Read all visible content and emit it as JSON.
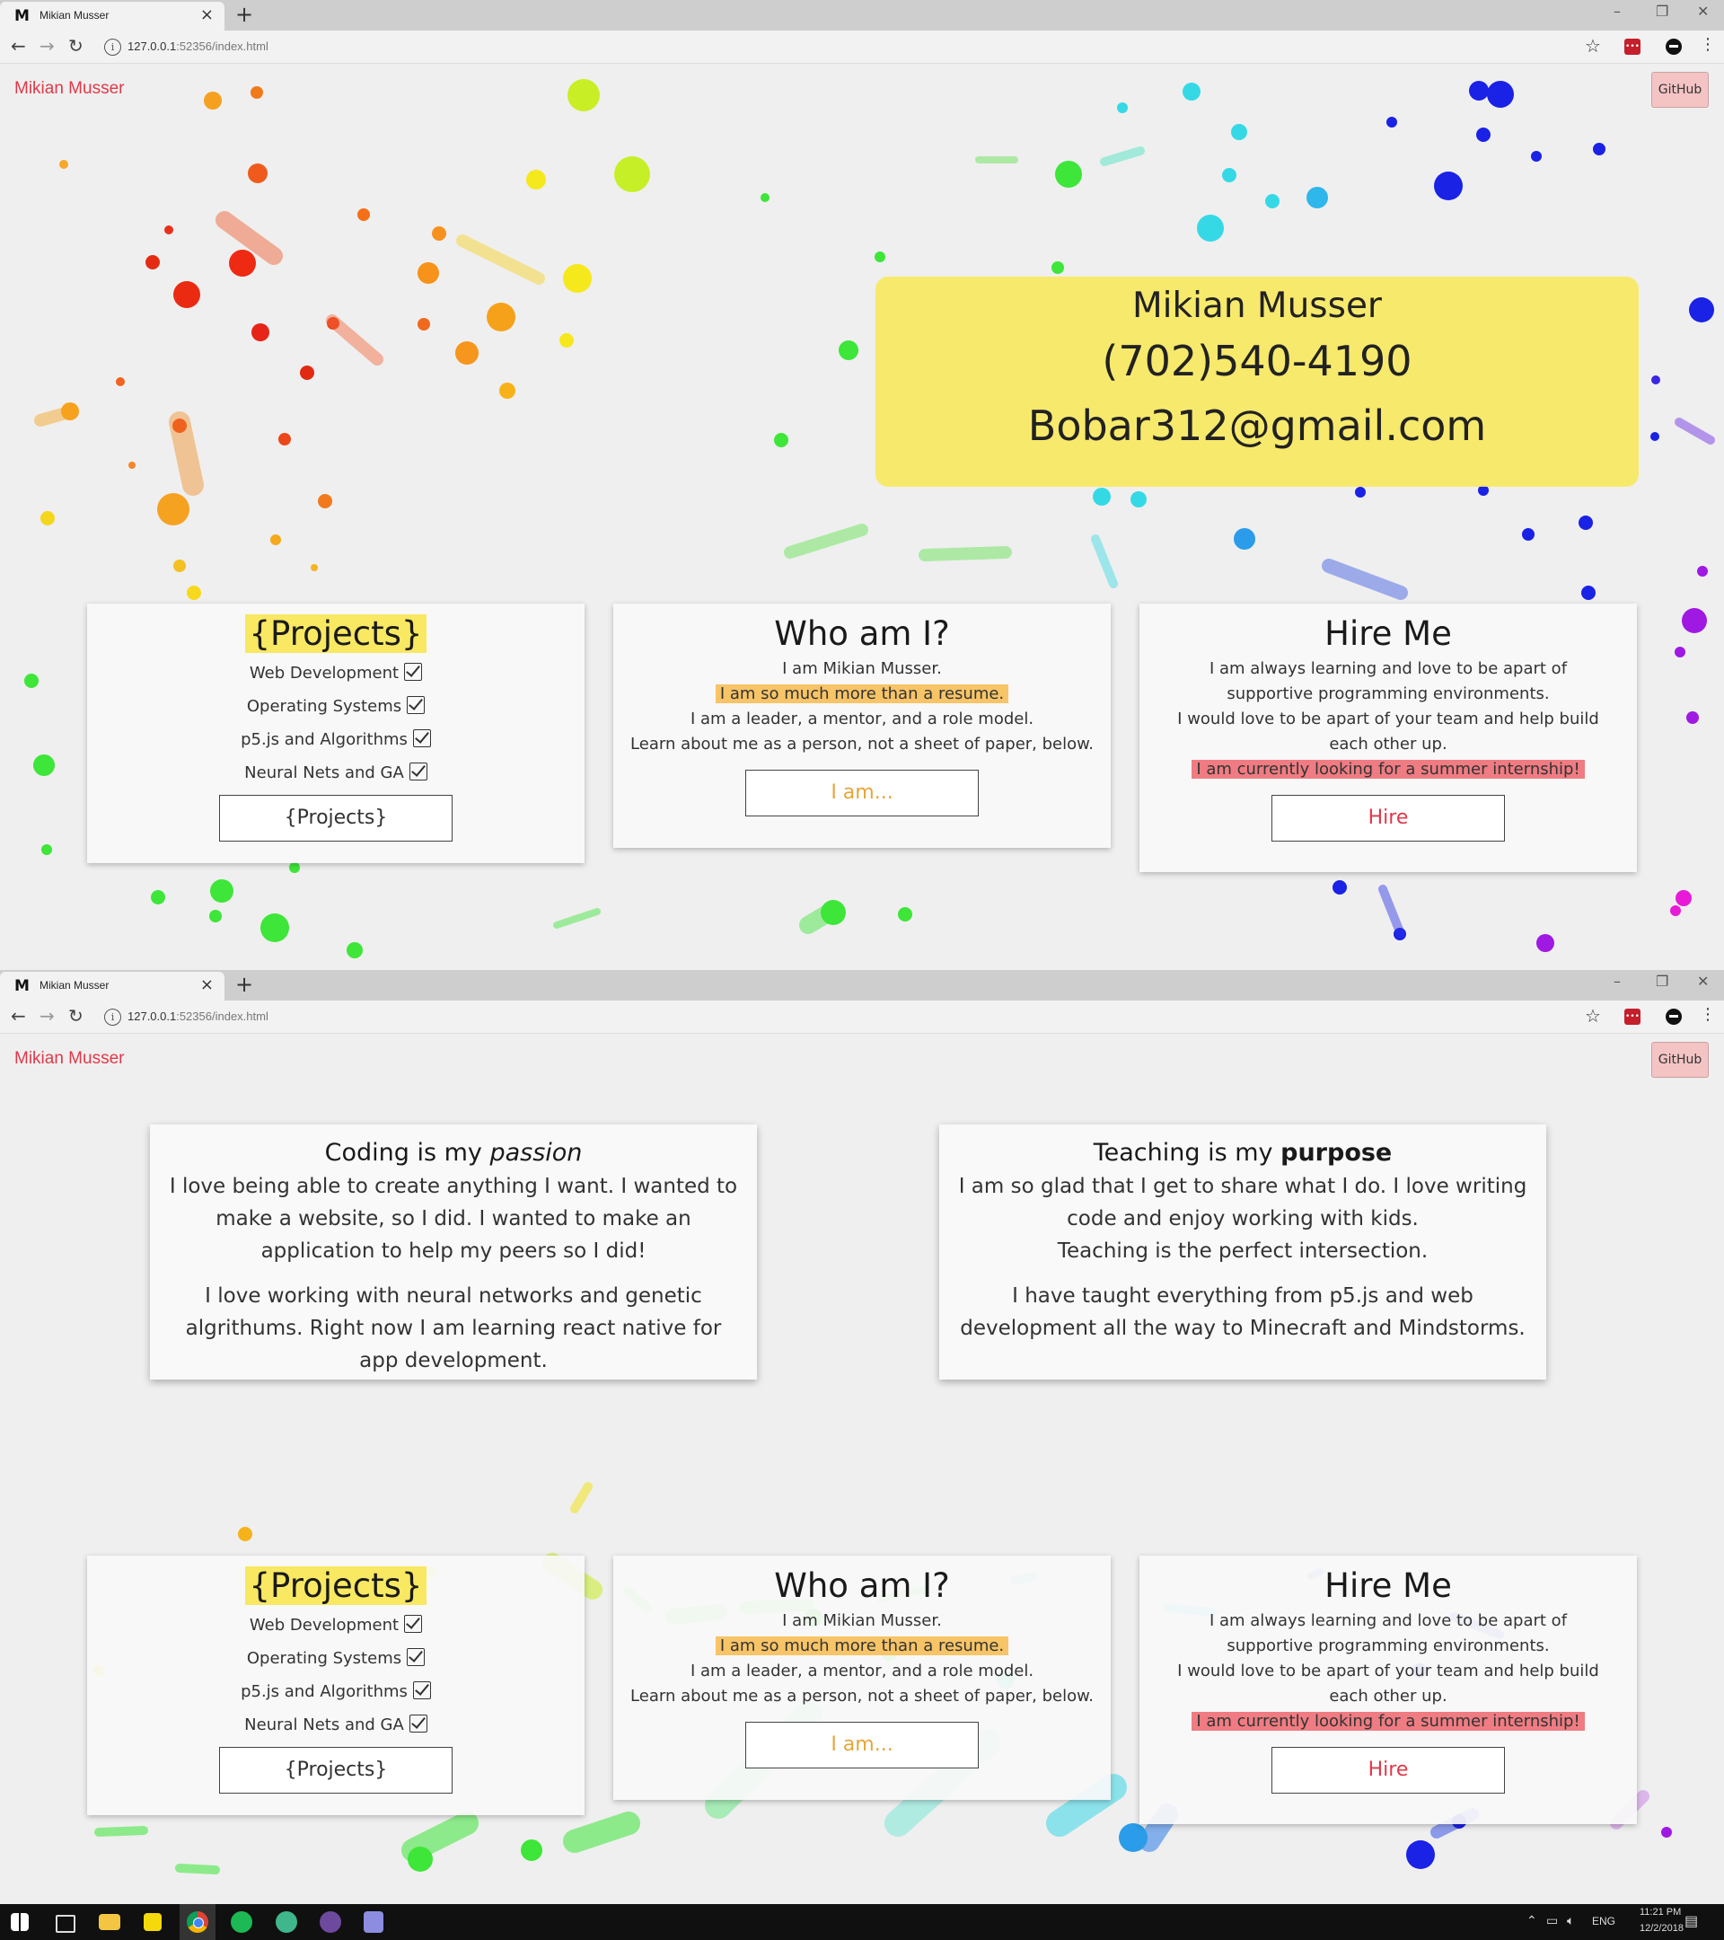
{
  "browser": {
    "tab_title": "Mikian Musser",
    "favicon": "M",
    "url_host": "127.0.0.1",
    "url_rest": ":52356/index.html",
    "new_tab_label": "+",
    "close_label": "×",
    "minimize_label": "–",
    "restore_label": "❐",
    "window_close_label": "✕",
    "back_label": "←",
    "forward_label": "→",
    "reload_label": "↻",
    "star_label": "☆",
    "menu_label": "⋮"
  },
  "nav": {
    "brand": "Mikian Musser",
    "github": "GitHub"
  },
  "contact": {
    "name": "Mikian Musser",
    "phone": "(702)540-4190",
    "email": "Bobar312@gmail.com"
  },
  "cards": {
    "projects": {
      "title": "{Projects}",
      "items": [
        "Web Development",
        "Operating Systems",
        "p5.js and Algorithms",
        "Neural Nets and GA"
      ],
      "button": "{Projects}"
    },
    "who": {
      "title": "Who am I?",
      "line1": "I am Mikian Musser.",
      "line2": "I am so much more than a resume.",
      "line3": "I am a leader, a mentor, and a role model.",
      "line4": "Learn about me as a person, not a sheet of paper, below.",
      "button": "I am..."
    },
    "hire": {
      "title": "Hire Me",
      "line1": "I am always learning and love to be apart of supportive programming environments.",
      "line2": "I would love to be apart of your team and help build each other up.",
      "line3": "I am currently looking for a summer internship!",
      "button": "Hire"
    }
  },
  "about": {
    "coding": {
      "title_pre": "Coding is my ",
      "title_em": "passion",
      "p1": "I love being able to create anything I want. I wanted to make a website, so I did. I wanted to make an application to help my peers so I did!",
      "p2": "I love working with neural networks and genetic algrithums. Right now I am learning react native for app development."
    },
    "teaching": {
      "title_pre": "Teaching is my ",
      "title_strong": "purpose",
      "p1a": "I am so glad that I get to share what I do. I love writing code and enjoy working with kids.",
      "p1b": "Teaching is the perfect intersection.",
      "p2": "I have taught everything from p5.js and web development all the way to Minecraft and Mindstorms."
    }
  },
  "taskbar": {
    "lang": "ENG",
    "time": "11:21 PM",
    "date": "12/2/2018",
    "icons": [
      "windows-start-icon",
      "task-view-icon",
      "file-explorer-icon",
      "sticky-notes-icon",
      "chrome-icon",
      "spotify-icon",
      "atom-icon",
      "github-desktop-icon",
      "snipping-tool-icon"
    ]
  },
  "colors": {
    "brand": "#e0394a",
    "yellow_highlight": "#f8e862",
    "orange_highlight": "#f7c467",
    "red_highlight": "#ef7c82",
    "github_button": "#f4c4c5"
  }
}
